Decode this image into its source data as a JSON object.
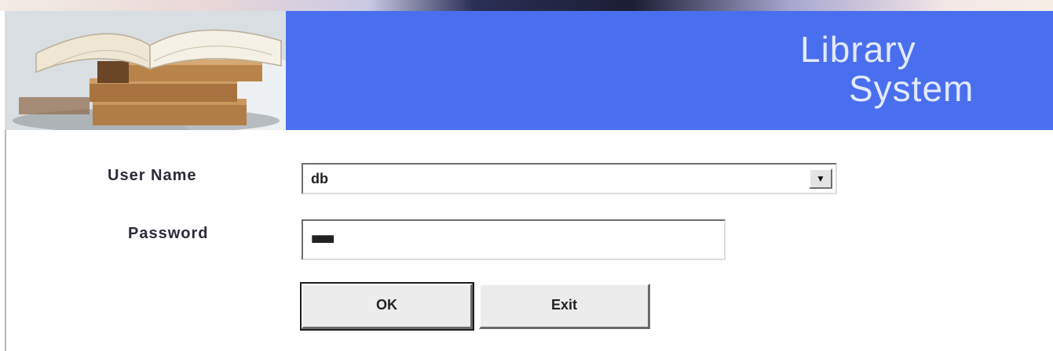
{
  "header": {
    "title_line1": "Library",
    "title_line2": "System",
    "banner_color": "#4a6fee"
  },
  "form": {
    "user_name_label": "User Name",
    "user_name_value": "db",
    "password_label": "Password",
    "password_value": "■■■"
  },
  "buttons": {
    "ok_label": "OK",
    "exit_label": "Exit"
  },
  "icons": {
    "dropdown": "chevron-down-icon",
    "logo": "books-illustration"
  }
}
